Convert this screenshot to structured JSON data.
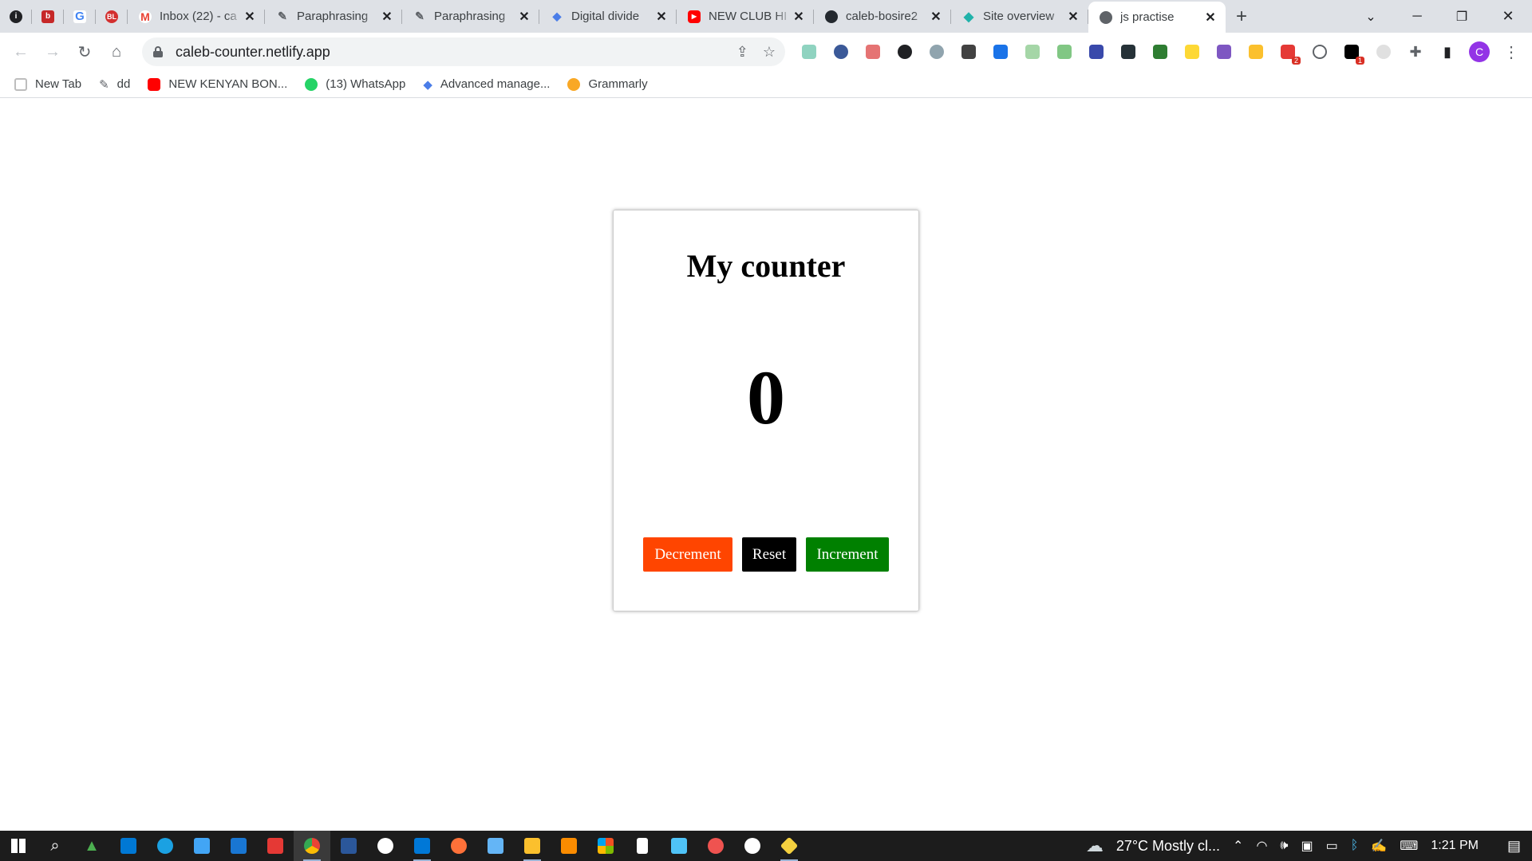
{
  "browser": {
    "pinned_tabs": [
      {
        "icon": "info-icon",
        "color": "#202124",
        "glyph": "i"
      },
      {
        "icon": "red-square-icon",
        "color": "#c62828",
        "glyph": "b"
      },
      {
        "icon": "google-icon",
        "color": "#4285f4",
        "glyph": "G"
      },
      {
        "icon": "bl-icon",
        "color": "#d32f2f",
        "glyph": "BL"
      }
    ],
    "tabs": [
      {
        "title": "Inbox (22) - ca",
        "icon": "gmail-icon",
        "color": "#ea4335"
      },
      {
        "title": "Paraphrasing",
        "icon": "quill-icon",
        "color": "#5f6368"
      },
      {
        "title": "Paraphrasing",
        "icon": "quill-icon",
        "color": "#5f6368"
      },
      {
        "title": "Digital divide",
        "icon": "diamond-icon",
        "color": "#4a7de8"
      },
      {
        "title": "NEW CLUB HI",
        "icon": "youtube-icon",
        "color": "#ff0000"
      },
      {
        "title": "caleb-bosire2",
        "icon": "github-icon",
        "color": "#24292f"
      },
      {
        "title": "Site overview",
        "icon": "netlify-icon",
        "color": "#20b2aa"
      },
      {
        "title": "js practise",
        "icon": "globe-icon",
        "color": "#5f6368"
      }
    ],
    "close_glyph": "✕",
    "new_tab_glyph": "+",
    "url": "caleb-counter.netlify.app",
    "profile_initial": "C",
    "extension_badges": {
      "red_ext": "2",
      "dark_ext": "1"
    }
  },
  "bookmarks": [
    {
      "label": "New Tab",
      "icon": "newtab-icon",
      "color": "#d93025"
    },
    {
      "label": "dd",
      "icon": "quill-icon",
      "color": "#5f6368"
    },
    {
      "label": "NEW KENYAN BON...",
      "icon": "youtube-icon",
      "color": "#ff0000"
    },
    {
      "label": "(13) WhatsApp",
      "icon": "whatsapp-icon",
      "color": "#25d366"
    },
    {
      "label": "Advanced manage...",
      "icon": "diamond-icon",
      "color": "#4a7de8"
    },
    {
      "label": "Grammarly",
      "icon": "grammarly-icon",
      "color": "#15c39a"
    }
  ],
  "counter": {
    "title": "My counter",
    "value": "0",
    "buttons": {
      "decrement": "Decrement",
      "reset": "Reset",
      "increment": "Increment"
    },
    "colors": {
      "decrement": "#ff4500",
      "reset": "#000000",
      "increment": "#008000"
    }
  },
  "taskbar": {
    "weather": "27°C  Mostly cl...",
    "time": "1:21 PM"
  }
}
